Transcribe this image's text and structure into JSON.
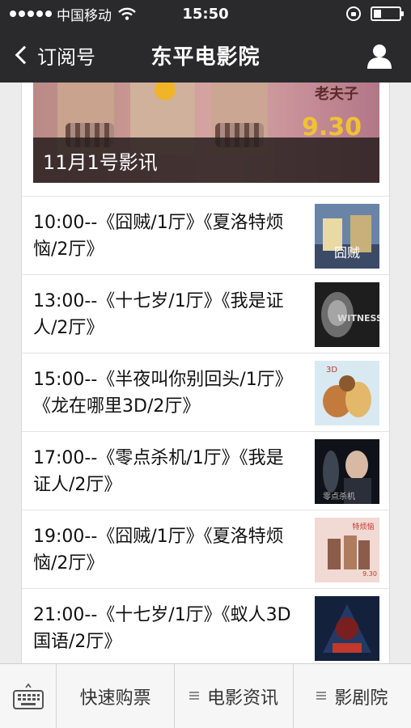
{
  "status_bar": {
    "carrier": "中国移动",
    "time": "15:50",
    "battery_level": 0.3
  },
  "nav": {
    "back_label": "订阅号",
    "title": "东平电影院"
  },
  "hero": {
    "caption": "11月1号影讯",
    "poster_date": "9.30",
    "poster_tag": "老夫子"
  },
  "schedule": [
    {
      "text": "10:00--《囧贼/1厅》《夏洛特烦恼/2厅》",
      "thumb": "poster-thief"
    },
    {
      "text": "13:00--《十七岁/1厅》《我是证人/2厅》",
      "thumb": "poster-witness"
    },
    {
      "text": "15:00--《半夜叫你别回头/1厅》《龙在哪里3D/2厅》",
      "thumb": "poster-dragon"
    },
    {
      "text": "17:00--《零点杀机/1厅》《我是证人/2厅》",
      "thumb": "poster-zero"
    },
    {
      "text": "19:00--《囧贼/1厅》《夏洛特烦恼/2厅》",
      "thumb": "poster-charlotte"
    },
    {
      "text": "21:00--《十七岁/1厅》《蚁人3D国语/2厅》",
      "thumb": "poster-antman"
    }
  ],
  "bottom_menu": {
    "items": [
      "快速购票",
      "电影资讯",
      "影剧院"
    ]
  },
  "colors": {
    "topbar": "#2a2a2c",
    "content_bg": "#ffffff",
    "page_bg": "#ececec"
  }
}
